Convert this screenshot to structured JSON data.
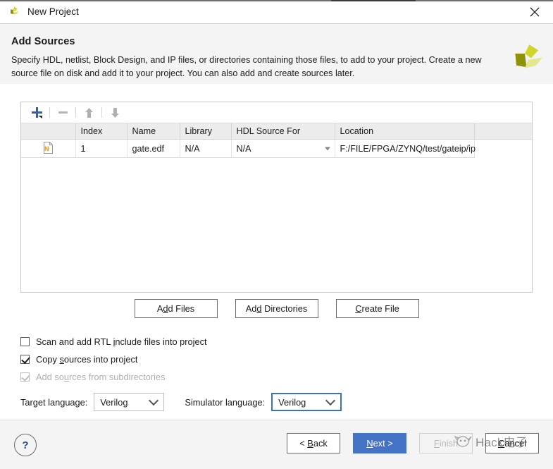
{
  "window": {
    "title": "New Project",
    "app_icon": "xilinx-logo-icon",
    "close_icon": "close-icon"
  },
  "header": {
    "title": "Add Sources",
    "description": "Specify HDL, netlist, Block Design, and IP files, or directories containing those files, to add to your project. Create a new source file on disk and add it to your project. You can also add and create sources later.",
    "logo_icon": "xilinx-pinwheel-logo"
  },
  "toolbar": {
    "add_icon": "plus-icon",
    "remove_icon": "minus-icon",
    "move_up_icon": "arrow-up-icon",
    "move_down_icon": "arrow-down-icon"
  },
  "table": {
    "columns": [
      "",
      "Index",
      "Name",
      "Library",
      "HDL Source For",
      "Location",
      ""
    ],
    "rows": [
      {
        "icon": "netlist-file-icon",
        "index": "1",
        "name": "gate.edf",
        "library": "N/A",
        "hdl_source_for": "N/A",
        "location": "F:/FILE/FPGA/ZYNQ/test/gateip/ip"
      }
    ]
  },
  "actions": {
    "add_files": {
      "pre": "A",
      "mnemonic": "d",
      "post": "d Files"
    },
    "add_directories": {
      "pre": "Ad",
      "mnemonic": "d",
      "post": " Directories"
    },
    "create_file": {
      "pre": "",
      "mnemonic": "C",
      "post": "reate File"
    }
  },
  "options": [
    {
      "id": "scan-rtl-include",
      "pre": "Scan and add RTL ",
      "mnemonic": "i",
      "post": "nclude files into project",
      "checked": false,
      "disabled": false
    },
    {
      "id": "copy-sources",
      "pre": "Copy ",
      "mnemonic": "s",
      "post": "ources into project",
      "checked": true,
      "disabled": false
    },
    {
      "id": "add-sources-subdirs",
      "pre": "Add so",
      "mnemonic": "u",
      "post": "rces from subdirectories",
      "checked": true,
      "disabled": true
    }
  ],
  "languages": {
    "target_label": "Target language:",
    "target_value": "Verilog",
    "simulator_label": "Simulator language:",
    "simulator_value": "Verilog"
  },
  "footer": {
    "help_glyph": "?",
    "back": {
      "pre": "< ",
      "mnemonic": "B",
      "post": "ack"
    },
    "next": {
      "pre": "",
      "mnemonic": "N",
      "post": "ext >"
    },
    "finish": {
      "pre": "",
      "mnemonic": "F",
      "post": "inish"
    },
    "cancel": {
      "pre": "",
      "mnemonic": "C",
      "post": "ancel"
    }
  },
  "watermark": {
    "text": "Hack电子",
    "icon": "watermark-logo-icon"
  },
  "colors": {
    "accent_blue": "#4472c4",
    "focus_blue": "#3d6fc4",
    "header_bg": "#f4f4f4",
    "logo_green": "#c2d22e",
    "file_icon_orange": "#e8920a"
  }
}
